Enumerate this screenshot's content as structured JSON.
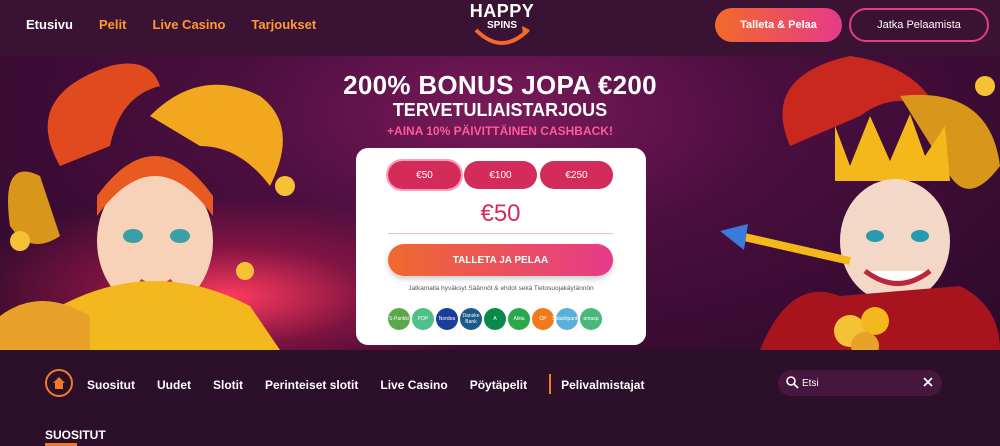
{
  "nav": {
    "items": [
      {
        "label": "Etusivu",
        "active": true
      },
      {
        "label": "Pelit",
        "active": false
      },
      {
        "label": "Live Casino",
        "active": false
      },
      {
        "label": "Tarjoukset",
        "active": false
      }
    ]
  },
  "logo": {
    "line1": "HAPPY",
    "line2": "SPINS"
  },
  "header": {
    "deposit_label": "Talleta & Pelaa",
    "continue_label": "Jatka Pelaamista"
  },
  "hero": {
    "title": "200% BONUS JOPA €200",
    "subtitle": "TERVETULIAISTARJOUS",
    "cashback": "+AINA 10% PÄIVITTÄINEN CASHBACK!"
  },
  "deposit_card": {
    "amounts": [
      "€50",
      "€100",
      "€250"
    ],
    "selected_amount": "€50",
    "cta_label": "TALLETA JA PELAA",
    "terms": "Jatkamalla hyväksyt Säännöt & ehdot sekä Tietosuojakäytännön",
    "banks": [
      {
        "name": "S-Pankki",
        "color": "#5aa84a"
      },
      {
        "name": "POP",
        "color": "#4fc08a"
      },
      {
        "name": "Nordea",
        "color": "#1a3f9a"
      },
      {
        "name": "Danske Bank",
        "color": "#1b5a8a"
      },
      {
        "name": "A",
        "color": "#0a8a4a"
      },
      {
        "name": "Aktia",
        "color": "#2aa84a"
      },
      {
        "name": "OP",
        "color": "#f07a1a"
      },
      {
        "name": "Säästöpankki",
        "color": "#5ab0d8"
      },
      {
        "name": "omasp",
        "color": "#4ab87a"
      }
    ]
  },
  "categories": {
    "items": [
      "Suositut",
      "Uudet",
      "Slotit",
      "Perinteiset slotit",
      "Live Casino",
      "Pöytäpelit"
    ],
    "after_separator": "Pelivalmistajat"
  },
  "search": {
    "placeholder": "Etsi"
  },
  "section": {
    "title": "SUOSITUT"
  },
  "colors": {
    "accent_orange": "#f07a2a",
    "accent_pink": "#e63a8a",
    "bg": "#2a0f26"
  }
}
